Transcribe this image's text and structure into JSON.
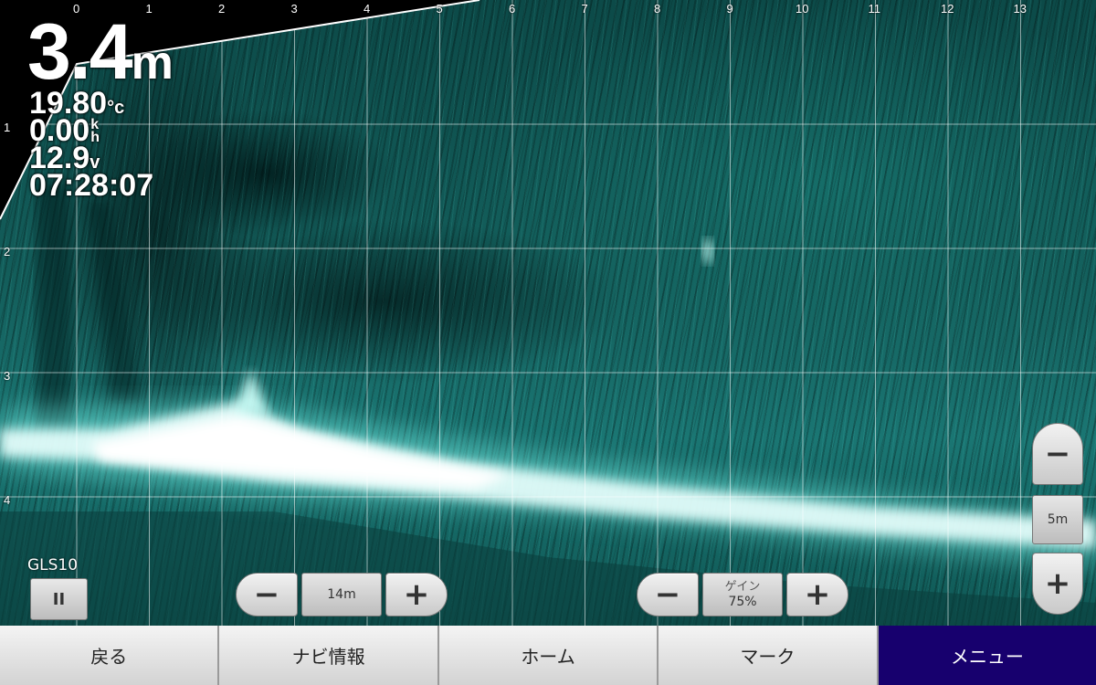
{
  "readouts": {
    "depth_value": "3.4",
    "depth_unit": "m",
    "water_temp": "19.80",
    "water_temp_unit": "°c",
    "speed": "0.00",
    "speed_unit_top": "k",
    "speed_unit_bottom": "h",
    "voltage": "12.9",
    "voltage_unit": "v",
    "time": "07:28:07"
  },
  "axes": {
    "top_ticks": [
      "0",
      "1",
      "2",
      "3",
      "4",
      "5",
      "6",
      "7",
      "8",
      "9",
      "10",
      "11",
      "12",
      "13"
    ],
    "left_ticks": [
      "1",
      "2",
      "3",
      "4"
    ]
  },
  "source": {
    "label": "GLS10",
    "pause_glyph": "II"
  },
  "range_control": {
    "minus": "−",
    "value": "14m",
    "plus": "+"
  },
  "gain_control": {
    "minus": "−",
    "label": "ゲイン",
    "value": "75%",
    "plus": "+"
  },
  "depth_zoom": {
    "minus": "−",
    "value": "5m",
    "plus": "+"
  },
  "softkeys": [
    {
      "label": "戻る",
      "active": false
    },
    {
      "label": "ナビ情報",
      "active": false
    },
    {
      "label": "ホーム",
      "active": false
    },
    {
      "label": "マーク",
      "active": false
    },
    {
      "label": "メニュー",
      "active": true
    }
  ],
  "colors": {
    "sonar_echo": "#1a7673",
    "active_softkey": "#17006e"
  }
}
